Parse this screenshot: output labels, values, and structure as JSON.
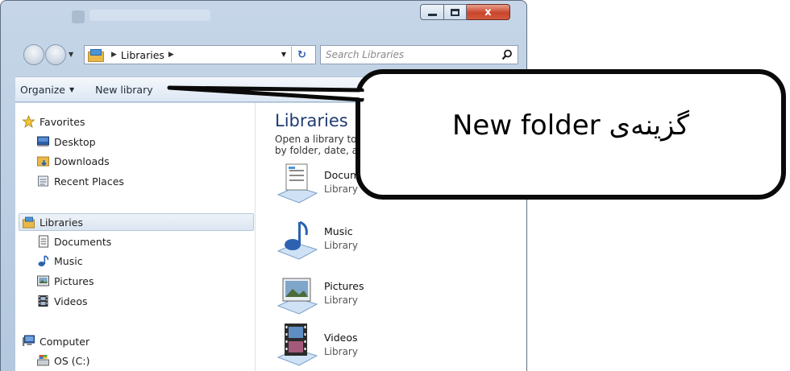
{
  "window": {
    "controls": {
      "close_glyph": "x"
    }
  },
  "address_bar": {
    "breadcrumb": [
      "Libraries"
    ],
    "search_placeholder": "Search Libraries"
  },
  "command_bar": {
    "organize_label": "Organize",
    "new_library_label": "New library"
  },
  "nav_pane": {
    "favorites": {
      "label": "Favorites",
      "items": [
        "Desktop",
        "Downloads",
        "Recent Places"
      ]
    },
    "libraries": {
      "label": "Libraries",
      "items": [
        "Documents",
        "Music",
        "Pictures",
        "Videos"
      ]
    },
    "computer": {
      "label": "Computer",
      "items": [
        "OS (C:)"
      ]
    }
  },
  "main_pane": {
    "heading": "Libraries",
    "subtitle": "Open a library to see your files and arrange them by folder, date, and other properties.",
    "libraries": [
      {
        "name": "Documents",
        "kind": "Library",
        "icon": "documents-library-icon"
      },
      {
        "name": "Music",
        "kind": "Library",
        "icon": "music-library-icon"
      },
      {
        "name": "Pictures",
        "kind": "Library",
        "icon": "pictures-library-icon"
      },
      {
        "name": "Videos",
        "kind": "Library",
        "icon": "videos-library-icon"
      }
    ]
  },
  "callout": {
    "text": "گزینه‌ی New folder"
  }
}
